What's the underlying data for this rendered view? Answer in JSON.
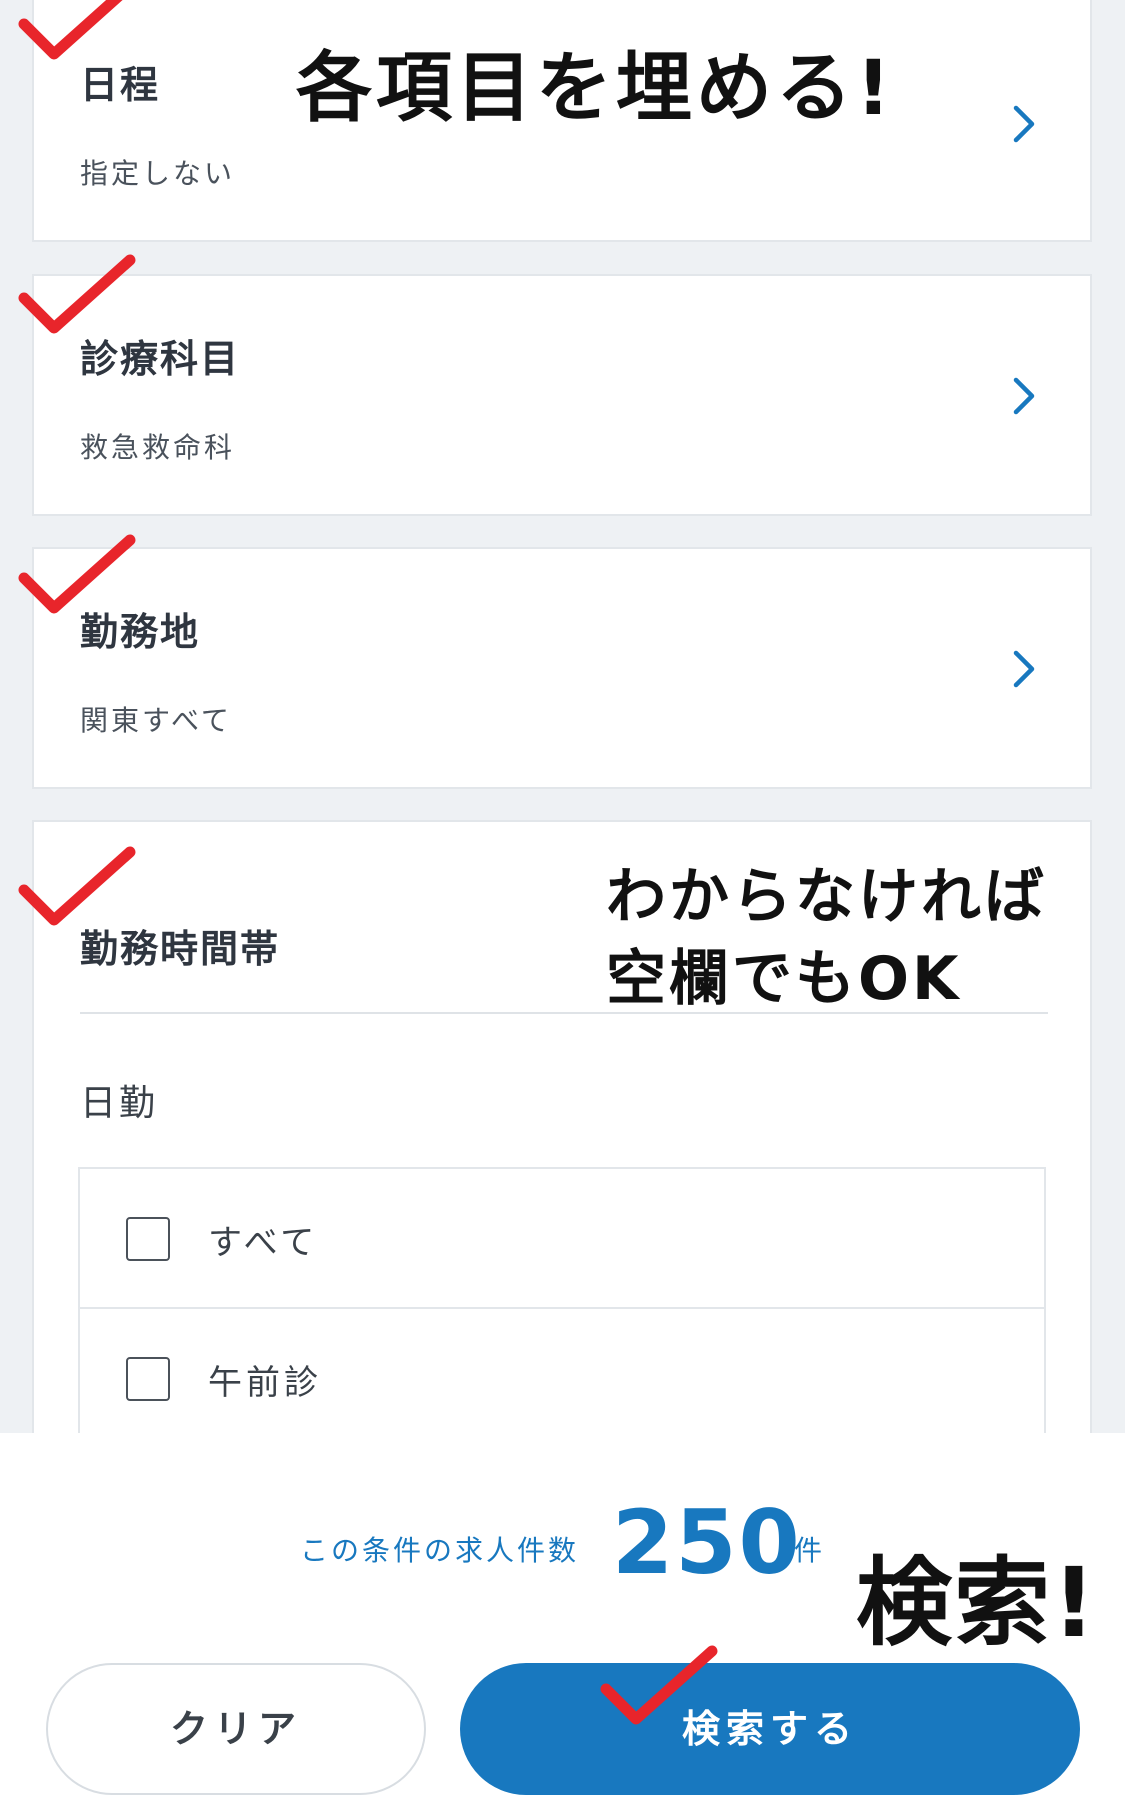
{
  "cards": [
    {
      "title": "日程",
      "value": "指定しない"
    },
    {
      "title": "診療科目",
      "value": "救急救命科"
    },
    {
      "title": "勤務地",
      "value": "関東すべて"
    }
  ],
  "time_section": {
    "title": "勤務時間帯",
    "group_label": "日勤",
    "options": [
      {
        "label": "すべて",
        "checked": false
      },
      {
        "label": "午前診",
        "checked": false
      }
    ]
  },
  "annotations": {
    "fill_all": "各項目を埋める!",
    "blank_ok_line1": "わからなければ",
    "blank_ok_line2": "空欄でもOK",
    "search_note": "検索!"
  },
  "footer": {
    "count_prefix": "この条件の求人件数",
    "count": "250",
    "count_unit": "件",
    "clear_label": "クリア",
    "search_label": "検索する"
  },
  "colors": {
    "accent": "#1878bf",
    "check_mark": "#e8252b",
    "background": "#eef1f4"
  }
}
